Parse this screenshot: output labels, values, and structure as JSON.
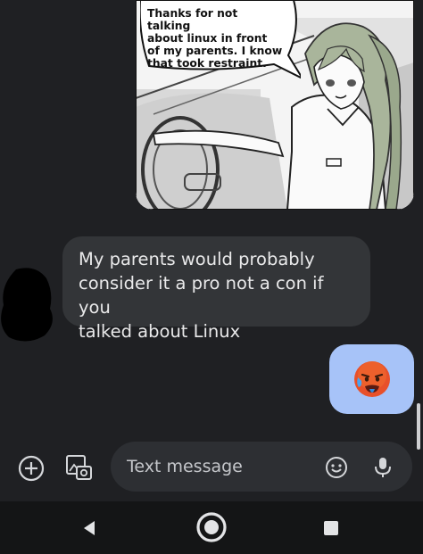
{
  "conversation": {
    "image_message": {
      "speech_text": "Thanks for not talking\nabout linux in front\nof my parents. I know\nthat took restraint."
    },
    "received_message": {
      "text": "My parents would probably\nconsider it a pro not a con if you\ntalked about Linux"
    },
    "sent_message": {
      "emoji": "hot-face-emoji"
    }
  },
  "compose": {
    "attach_icon": "plus-circle-icon",
    "gallery_icon": "gallery-icon",
    "placeholder": "Text message",
    "emoji_icon": "smiley-icon",
    "voice_icon": "microphone-icon"
  },
  "navbar": {
    "back_icon": "back-triangle-icon",
    "home_icon": "home-circle-icon",
    "recents_icon": "recents-square-icon"
  },
  "colors": {
    "background": "#1f2023",
    "bubble_in": "#333538",
    "bubble_out": "#a7c3f8",
    "input": "#2d2f33",
    "navbar": "#141516"
  }
}
